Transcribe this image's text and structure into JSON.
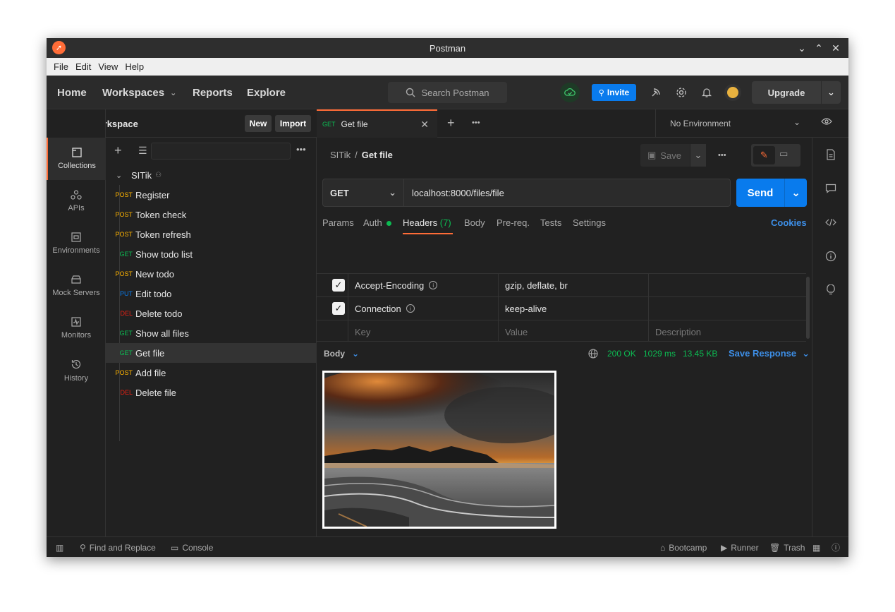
{
  "window": {
    "title": "Postman"
  },
  "menu": [
    "File",
    "Edit",
    "View",
    "Help"
  ],
  "header": {
    "nav": [
      "Home",
      "Workspaces",
      "Reports",
      "Explore"
    ],
    "search_placeholder": "Search Postman",
    "invite": "Invite",
    "upgrade": "Upgrade",
    "icons": [
      "sync-icon",
      "satellite-icon",
      "settings-icon",
      "bell-icon",
      "avatar"
    ]
  },
  "workspace": {
    "name": "My Workspace",
    "new": "New",
    "import": "Import"
  },
  "iconbar": [
    {
      "label": "Collections",
      "icon": "collections-icon",
      "active": true
    },
    {
      "label": "APIs",
      "icon": "apis-icon"
    },
    {
      "label": "Environments",
      "icon": "environments-icon"
    },
    {
      "label": "Mock Servers",
      "icon": "mock-servers-icon"
    },
    {
      "label": "Monitors",
      "icon": "monitors-icon"
    },
    {
      "label": "History",
      "icon": "history-icon"
    }
  ],
  "collection": {
    "name": "SITik",
    "requests": [
      {
        "method": "POST",
        "name": "Register"
      },
      {
        "method": "POST",
        "name": "Token check"
      },
      {
        "method": "POST",
        "name": "Token refresh"
      },
      {
        "method": "GET",
        "name": "Show todo list"
      },
      {
        "method": "POST",
        "name": "New todo"
      },
      {
        "method": "PUT",
        "name": "Edit todo"
      },
      {
        "method": "DEL",
        "name": "Delete todo"
      },
      {
        "method": "GET",
        "name": "Show all files"
      },
      {
        "method": "GET",
        "name": "Get file",
        "selected": true
      },
      {
        "method": "POST",
        "name": "Add file"
      },
      {
        "method": "DEL",
        "name": "Delete file"
      }
    ]
  },
  "tab": {
    "method": "GET",
    "name": "Get file"
  },
  "environment": "No Environment",
  "breadcrumb": {
    "collection": "SITik",
    "separator": "/",
    "request": "Get file"
  },
  "save": "Save",
  "request": {
    "method": "GET",
    "url": "localhost:8000/files/file",
    "send": "Send"
  },
  "subtabs": {
    "params": "Params",
    "auth": "Auth",
    "headers": "Headers",
    "headers_count": "(7)",
    "body": "Body",
    "prereq": "Pre-req.",
    "tests": "Tests",
    "settings": "Settings",
    "cookies": "Cookies"
  },
  "headers": [
    {
      "key": "Accept-Encoding",
      "value": "gzip, deflate, br",
      "checked": true
    },
    {
      "key": "Connection",
      "value": "keep-alive",
      "checked": true
    }
  ],
  "headers_placeholder": {
    "key": "Key",
    "value": "Value",
    "description": "Description"
  },
  "response": {
    "label": "Body",
    "status": "200 OK",
    "time": "1029 ms",
    "size": "13.45 KB",
    "save": "Save Response"
  },
  "statusbar": {
    "find_replace": "Find and Replace",
    "console": "Console",
    "bootcamp": "Bootcamp",
    "runner": "Runner",
    "trash": "Trash"
  },
  "colors": {
    "accent": "#ff6c37",
    "primary": "#097bed",
    "get": "#0cbb52",
    "post": "#ffb400",
    "put": "#097bed",
    "del": "#eb2013"
  }
}
